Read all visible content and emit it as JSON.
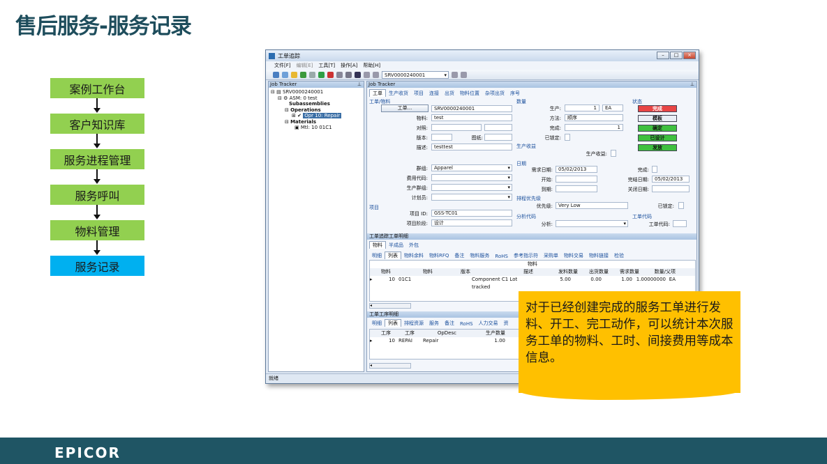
{
  "slide": {
    "title": "售后服务-服务记录",
    "logo": "EPICOR"
  },
  "flow": [
    {
      "label": "案例工作台",
      "active": false
    },
    {
      "label": "客户知识库",
      "active": false
    },
    {
      "label": "服务进程管理",
      "active": false
    },
    {
      "label": "服务呼叫",
      "active": false
    },
    {
      "label": "物料管理",
      "active": false
    },
    {
      "label": "服务记录",
      "active": true
    }
  ],
  "window": {
    "title": "工单追踪",
    "menu": [
      "文件[F]",
      "编辑[E]",
      "工具[T]",
      "操作[A]",
      "帮助[H]"
    ],
    "toolbar_job": "SRV0000240001",
    "status": "就绪"
  },
  "left_pane": {
    "header": "Job Tracker",
    "tree": {
      "root": "SRV0000240001",
      "asm": "ASM: 0 test",
      "subassemblies": "Subassemblies",
      "operations": "Operations",
      "opr": "Opr 10: Repair",
      "materials": "Materials",
      "mtl": "Mtl: 10 01C1"
    }
  },
  "right_pane": {
    "header": "Job Tracker",
    "tabs": [
      "工单",
      "生产收货",
      "项目",
      "连接",
      "出货",
      "物料位置",
      "杂项出货",
      "序号"
    ],
    "job_group": "工单/物料",
    "job_btn": "工单...",
    "job_value": "SRV0000240001",
    "part_label": "物料:",
    "part_value": "test",
    "ref_label": "对照:",
    "rev_label": "版本:",
    "drawing_label": "图纸:",
    "desc_label": "描述:",
    "desc_value": "testtest",
    "qty_group": "数量",
    "prod_label": "生产:",
    "prod_value": "1",
    "prod_uom": "EA",
    "method_label": "方法:",
    "method_value": "顺序",
    "complete_label": "完成:",
    "complete_value": "1",
    "locked_label": "已锁定:",
    "yield_group": "生产收益",
    "yield_label": "生产收益:",
    "status_group": "状态",
    "status_buttons": [
      "完成",
      "模板",
      "确定",
      "已设计",
      "发放"
    ],
    "group_label": "群组:",
    "group_value": "Apparel",
    "cost_label": "费用代码:",
    "prod_team_label": "生产群组:",
    "planner_label": "计划员:",
    "date_group": "日期",
    "req_date_label": "需求日期:",
    "req_date_value": "05/02/2013",
    "start_label": "开始:",
    "due_label": "到期:",
    "done_label": "完成:",
    "close_date_label": "完结日期:",
    "close_date_value": "05/02/2013",
    "closed_date_label": "关闭日期:",
    "sched_group": "排程优先级",
    "priority_label": "优先级:",
    "priority_value": "Very Low",
    "locked2_label": "已锁定:",
    "project_group": "项目",
    "project_id_label": "项目 ID:",
    "project_id_value": "GSS-TC01",
    "phase_label": "项目阶段:",
    "phase_value": "设计",
    "analysis_group": "分析代码",
    "analysis_label": "分析:",
    "job_code_group": "工单代码",
    "job_code_label": "工单代码:",
    "detail_header": "工单追踪工单明细",
    "detail_tabs": [
      "物料",
      "半成品",
      "外包"
    ],
    "mtl_tabs": [
      "明细",
      "列表",
      "物料余料",
      "物料RFQ",
      "备注",
      "物料服务",
      "RoHS",
      "参考指示符",
      "采购单",
      "物料交易",
      "物料链接",
      "检验"
    ],
    "mtl_grid_title": "物料",
    "mtl_cols": [
      "物料",
      "物料",
      "版本",
      "描述",
      "发料数量",
      "出货数量",
      "需求数量",
      "数量/父项"
    ],
    "mtl_row": [
      "10",
      "01C1",
      "",
      "Component C1 Lot tracked",
      "5.00",
      "0.00",
      "1.00",
      "1.00000000",
      "EA"
    ],
    "opr_header": "工单工序明细",
    "opr_tabs": [
      "明细",
      "列表",
      "排程资源",
      "服务",
      "备注",
      "RoHS",
      "人力交易",
      "资"
    ],
    "opr_cols": [
      "工序",
      "工序",
      "OpDesc",
      "生产数量"
    ],
    "opr_row": [
      "10",
      "REPAI",
      "Repair",
      "1.00"
    ]
  },
  "callout": "对于已经创建完成的服务工单进行发料、开工、完工动作，可以统计本次服务工单的物料、工时、间接费用等成本信息。",
  "colors": {
    "title": "#1e4d5c",
    "flow_box": "#92d050",
    "flow_active": "#00b0f0",
    "footer": "#1f5564",
    "callout": "#ffc000"
  }
}
